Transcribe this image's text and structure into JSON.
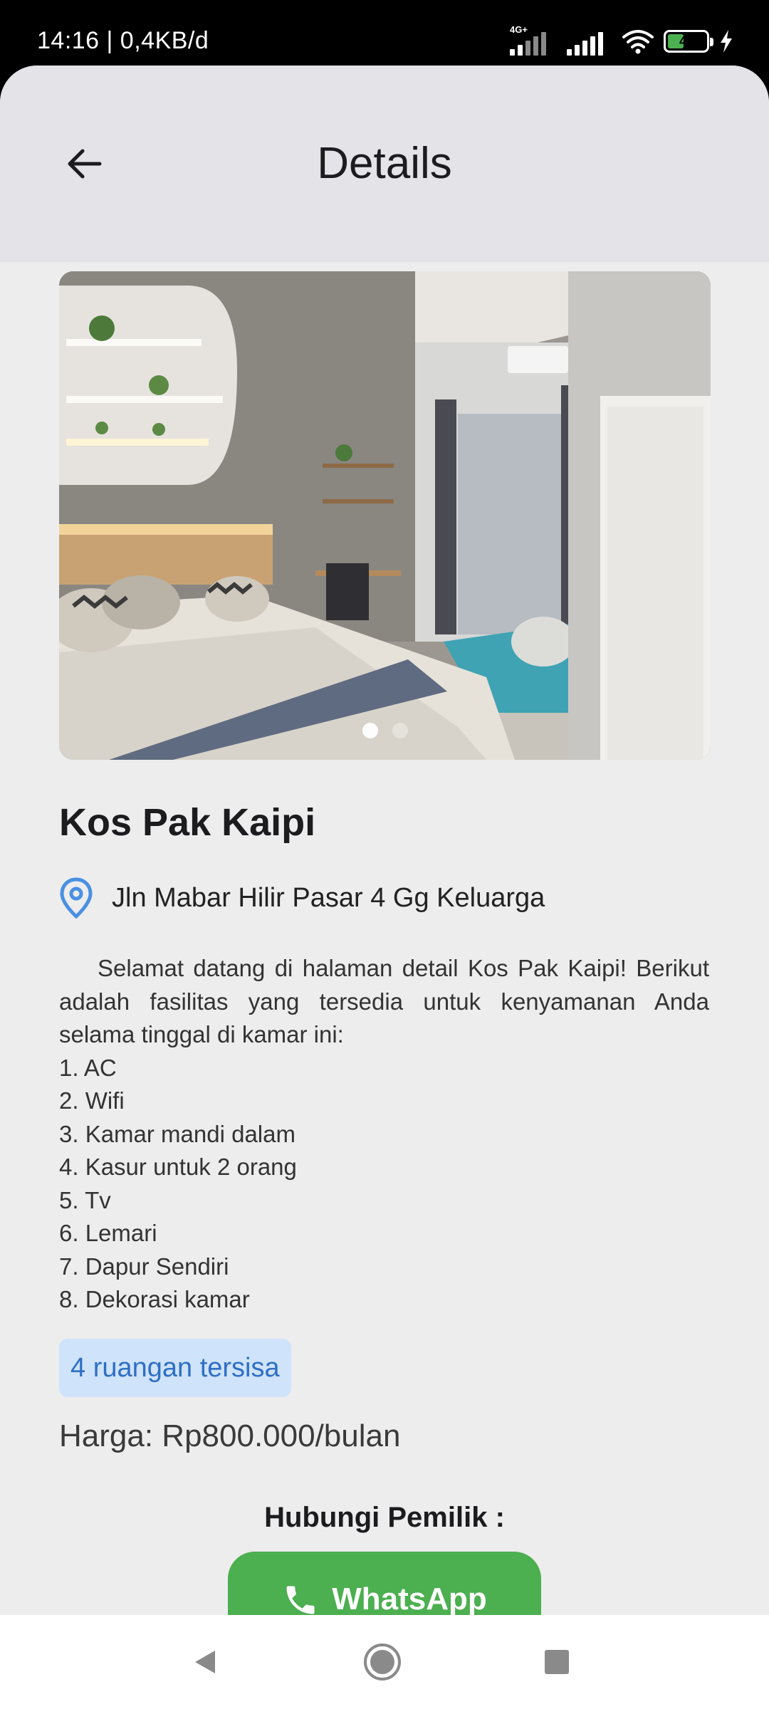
{
  "status_bar": {
    "time": "14:16 | 0,4KB/d",
    "network_type": "4G+",
    "battery_level": "45",
    "icons": [
      "signal-icon",
      "signal-icon",
      "wifi-icon",
      "battery-icon",
      "charging-icon"
    ]
  },
  "app_bar": {
    "title": "Details",
    "back_icon": "arrow-left-icon"
  },
  "carousel": {
    "page_count": 2,
    "active_index": 0
  },
  "listing": {
    "name": "Kos Pak Kaipi",
    "address_icon": "location-pin-icon",
    "address": "Jln Mabar Hilir Pasar 4 Gg Keluarga",
    "description_intro": "Selamat datang di halaman detail Kos Pak Kaipi! Berikut adalah fasilitas yang tersedia untuk kenyamanan Anda selama tinggal di kamar ini:",
    "facilities": [
      "1. AC",
      "2. Wifi",
      "3. Kamar mandi dalam",
      "4. Kasur untuk 2 orang",
      "5. Tv",
      "6. Lemari",
      "7. Dapur Sendiri",
      "8. Dekorasi kamar"
    ],
    "rooms_left": "4 ruangan tersisa",
    "price": "Harga: Rp800.000/bulan"
  },
  "contact": {
    "label": "Hubungi Pemilik :",
    "whatsapp_label": "WhatsApp",
    "whatsapp_icon": "phone-icon"
  },
  "nav_bar": {
    "buttons": [
      "back-triangle-icon",
      "home-circle-icon",
      "recents-square-icon"
    ]
  },
  "colors": {
    "accent_green": "#4caf50",
    "badge_bg": "#cfe3fb",
    "badge_text": "#2f6fc4",
    "pin_blue": "#4a90e2"
  }
}
